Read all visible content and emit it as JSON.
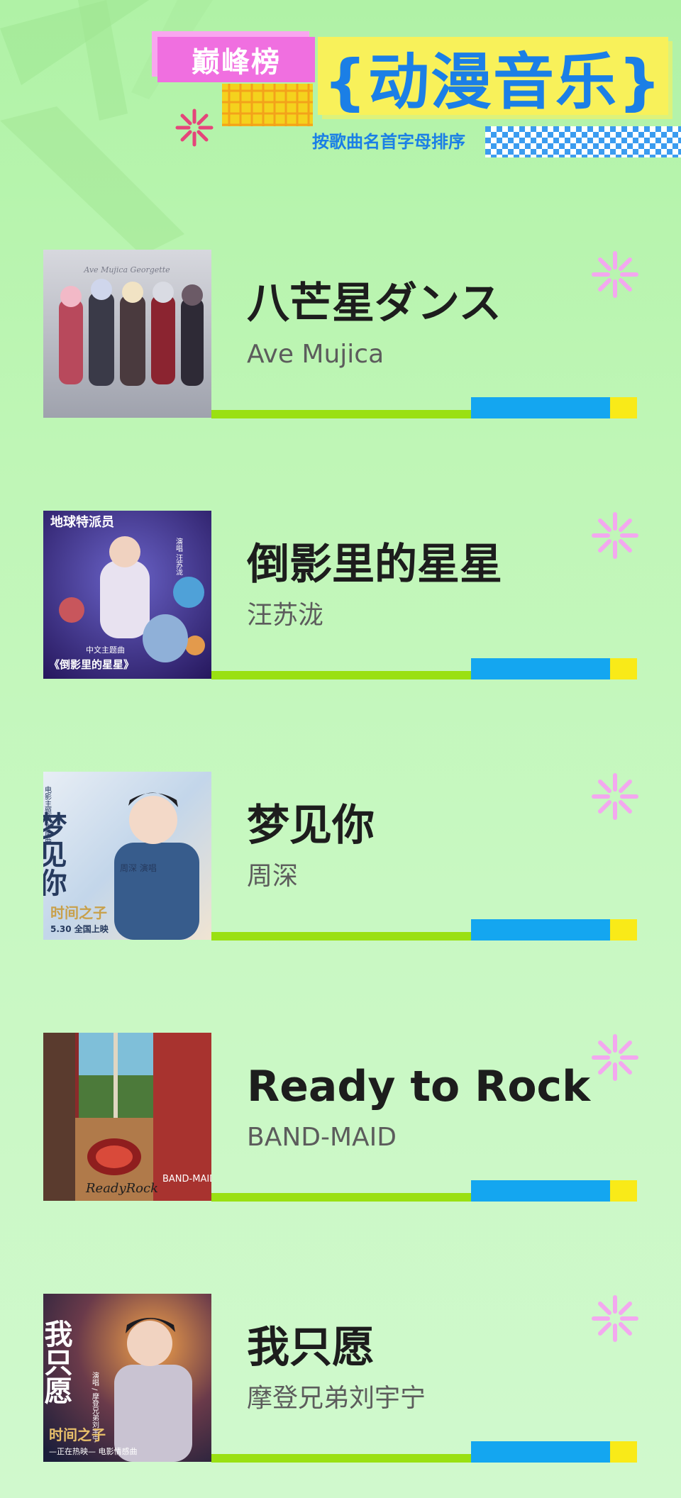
{
  "header": {
    "badge": "巅峰榜",
    "title": "{动漫音乐}",
    "subtitle": "按歌曲名首字母排序"
  },
  "songs": [
    {
      "title": "八芒星ダンス",
      "artist": "Ave Mujica",
      "cover_text": "Ave Mujica Georgette"
    },
    {
      "title": "倒影里的星星",
      "artist": "汪苏泷",
      "cover_text": "地球特派员",
      "cover_sub": "中文主题曲",
      "cover_song": "《倒影里的星星》",
      "cover_singer": "演唱 汪苏泷"
    },
    {
      "title": "梦见你",
      "artist": "周深",
      "cover_text": "梦见你",
      "cover_sub": "电影主题曲·片尾曲",
      "cover_singer": "周深 演唱",
      "cover_film": "时间之子",
      "cover_date": "5.30 全国上映"
    },
    {
      "title": "Ready to Rock",
      "artist": "BAND-MAID",
      "cover_text": "ReadyRock",
      "cover_band": "BAND-MAID"
    },
    {
      "title": "我只愿",
      "artist": "摩登兄弟刘宇宁",
      "cover_text": "我只愿",
      "cover_sub": "演唱 / 摩登兄弟刘宇宁",
      "cover_film": "时间之子",
      "cover_tag": "—正在热映— 电影情感曲"
    }
  ],
  "colors": {
    "accent_pink": "#f06fe0",
    "title_blue": "#1b7fe6",
    "title_bg_yellow": "#f8f15a",
    "bar_green": "#9ae012",
    "bar_blue": "#14a6f0",
    "bar_yellow": "#f9ea18"
  }
}
